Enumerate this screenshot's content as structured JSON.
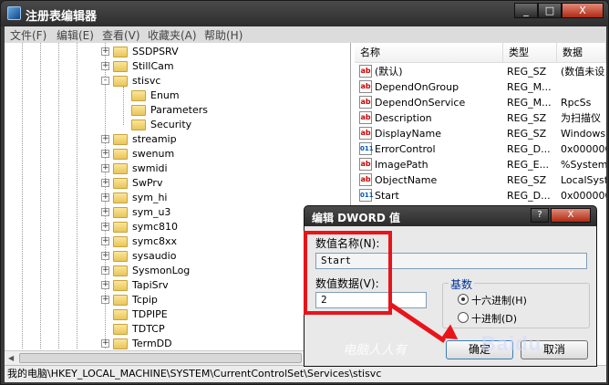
{
  "window": {
    "title": "注册表编辑器",
    "controls": {
      "minimize": "_",
      "maximize": "□",
      "close": "X"
    }
  },
  "menu": [
    "文件(F)",
    "编辑(E)",
    "查看(V)",
    "收藏夹(A)",
    "帮助(H)"
  ],
  "tree": [
    {
      "label": "SSDPSRV",
      "expander": "+"
    },
    {
      "label": "StillCam",
      "expander": "+"
    },
    {
      "label": "stisvc",
      "expander": "-",
      "open": true
    },
    {
      "label": "Enum",
      "expander": ""
    },
    {
      "label": "Parameters",
      "expander": ""
    },
    {
      "label": "Security",
      "expander": ""
    },
    {
      "label": "streamip",
      "expander": "+"
    },
    {
      "label": "swenum",
      "expander": "+"
    },
    {
      "label": "swmidi",
      "expander": "+"
    },
    {
      "label": "SwPrv",
      "expander": "+"
    },
    {
      "label": "sym_hi",
      "expander": "+"
    },
    {
      "label": "sym_u3",
      "expander": "+"
    },
    {
      "label": "symc810",
      "expander": "+"
    },
    {
      "label": "symc8xx",
      "expander": "+"
    },
    {
      "label": "sysaudio",
      "expander": "+"
    },
    {
      "label": "SysmonLog",
      "expander": "+"
    },
    {
      "label": "TapiSrv",
      "expander": "+"
    },
    {
      "label": "Tcpip",
      "expander": "+"
    },
    {
      "label": "TDPIPE",
      "expander": ""
    },
    {
      "label": "TDTCP",
      "expander": ""
    },
    {
      "label": "TermDD",
      "expander": "+"
    }
  ],
  "list": {
    "columns": {
      "name": "名称",
      "type": "类型",
      "data": "数据"
    },
    "rows": [
      {
        "icon": "ab",
        "kind": "str",
        "name": "(默认)",
        "type": "REG_SZ",
        "data": "(数值未设"
      },
      {
        "icon": "ab",
        "kind": "str",
        "name": "DependOnGroup",
        "type": "REG_M...",
        "data": ""
      },
      {
        "icon": "ab",
        "kind": "str",
        "name": "DependOnService",
        "type": "REG_M...",
        "data": "RpcSs"
      },
      {
        "icon": "ab",
        "kind": "str",
        "name": "Description",
        "type": "REG_SZ",
        "data": "为扫描仪"
      },
      {
        "icon": "ab",
        "kind": "str",
        "name": "DisplayName",
        "type": "REG_SZ",
        "data": "Windows"
      },
      {
        "icon": "011",
        "kind": "bin",
        "name": "ErrorControl",
        "type": "REG_D...",
        "data": "0x000000"
      },
      {
        "icon": "ab",
        "kind": "str",
        "name": "ImagePath",
        "type": "REG_E...",
        "data": "%Systeml"
      },
      {
        "icon": "ab",
        "kind": "str",
        "name": "ObjectName",
        "type": "REG_SZ",
        "data": "LocalSyste"
      },
      {
        "icon": "011",
        "kind": "bin",
        "name": "Start",
        "type": "REG_D...",
        "data": "0x000000"
      }
    ]
  },
  "statusbar": "我的电脑\\HKEY_LOCAL_MACHINE\\SYSTEM\\CurrentControlSet\\Services\\stisvc",
  "dialog": {
    "title": "编辑 DWORD 值",
    "close": "X",
    "value_name_label": "数值名称(N):",
    "value_name": "Start",
    "value_data_label": "数值数据(V):",
    "value_data": "2",
    "base_label": "基数",
    "hex_label": "十六进制(H)",
    "dec_label": "十进制(D)",
    "selected_base": "hex",
    "ok": "确定",
    "cancel": "取消"
  },
  "annotation": {
    "color": "#e8141a"
  },
  "watermark": {
    "text": "电脑人人有",
    "logo": "Baidu"
  }
}
